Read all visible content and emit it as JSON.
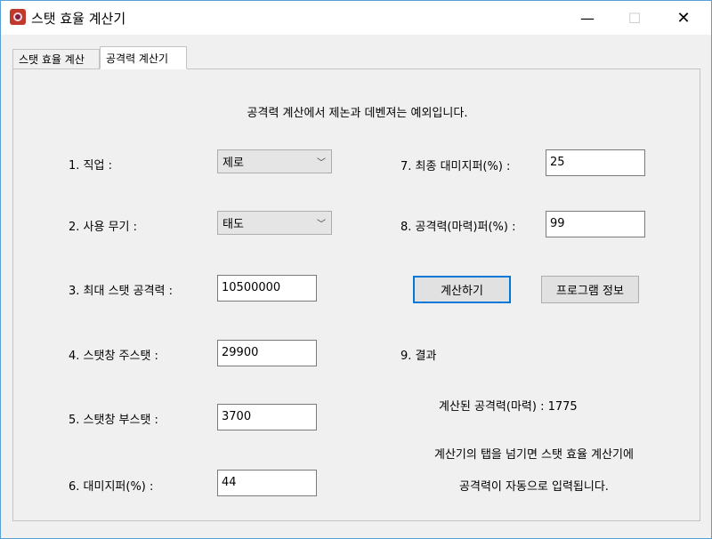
{
  "window": {
    "title": "스탯 효율 계산기",
    "minimize": "—",
    "maximize": "☐",
    "close": "✕"
  },
  "tabs": [
    {
      "label": "스탯 효율 계산"
    },
    {
      "label": "공격력 계산기"
    }
  ],
  "panel": {
    "notice": "공격력 계산에서 제논과 데벤져는 예외입니다.",
    "fields": {
      "job_label": "1. 직업 :",
      "job_value": "제로",
      "weapon_label": "2. 사용 무기 :",
      "weapon_value": "태도",
      "max_atk_label": "3. 최대 스탯 공격력 :",
      "max_atk_value": "10500000",
      "main_stat_label": "4. 스탯창 주스탯 :",
      "main_stat_value": "29900",
      "sub_stat_label": "5. 스탯창 부스탯 :",
      "sub_stat_value": "3700",
      "dmg_label": "6. 대미지퍼(%) :",
      "dmg_value": "44",
      "final_dmg_label": "7. 최종 대미지퍼(%) :",
      "final_dmg_value": "25",
      "atk_pct_label": "8. 공격력(마력)퍼(%) :",
      "atk_pct_value": "99",
      "result_label": "9. 결과"
    },
    "buttons": {
      "calculate": "계산하기",
      "program_info": "프로그램 정보"
    },
    "result_text": "계산된 공격력(마력) : 1775",
    "info_line1": "계산기의 탭을 넘기면 스탯 효율 계산기에",
    "info_line2": "공격력이 자동으로 입력됩니다."
  }
}
